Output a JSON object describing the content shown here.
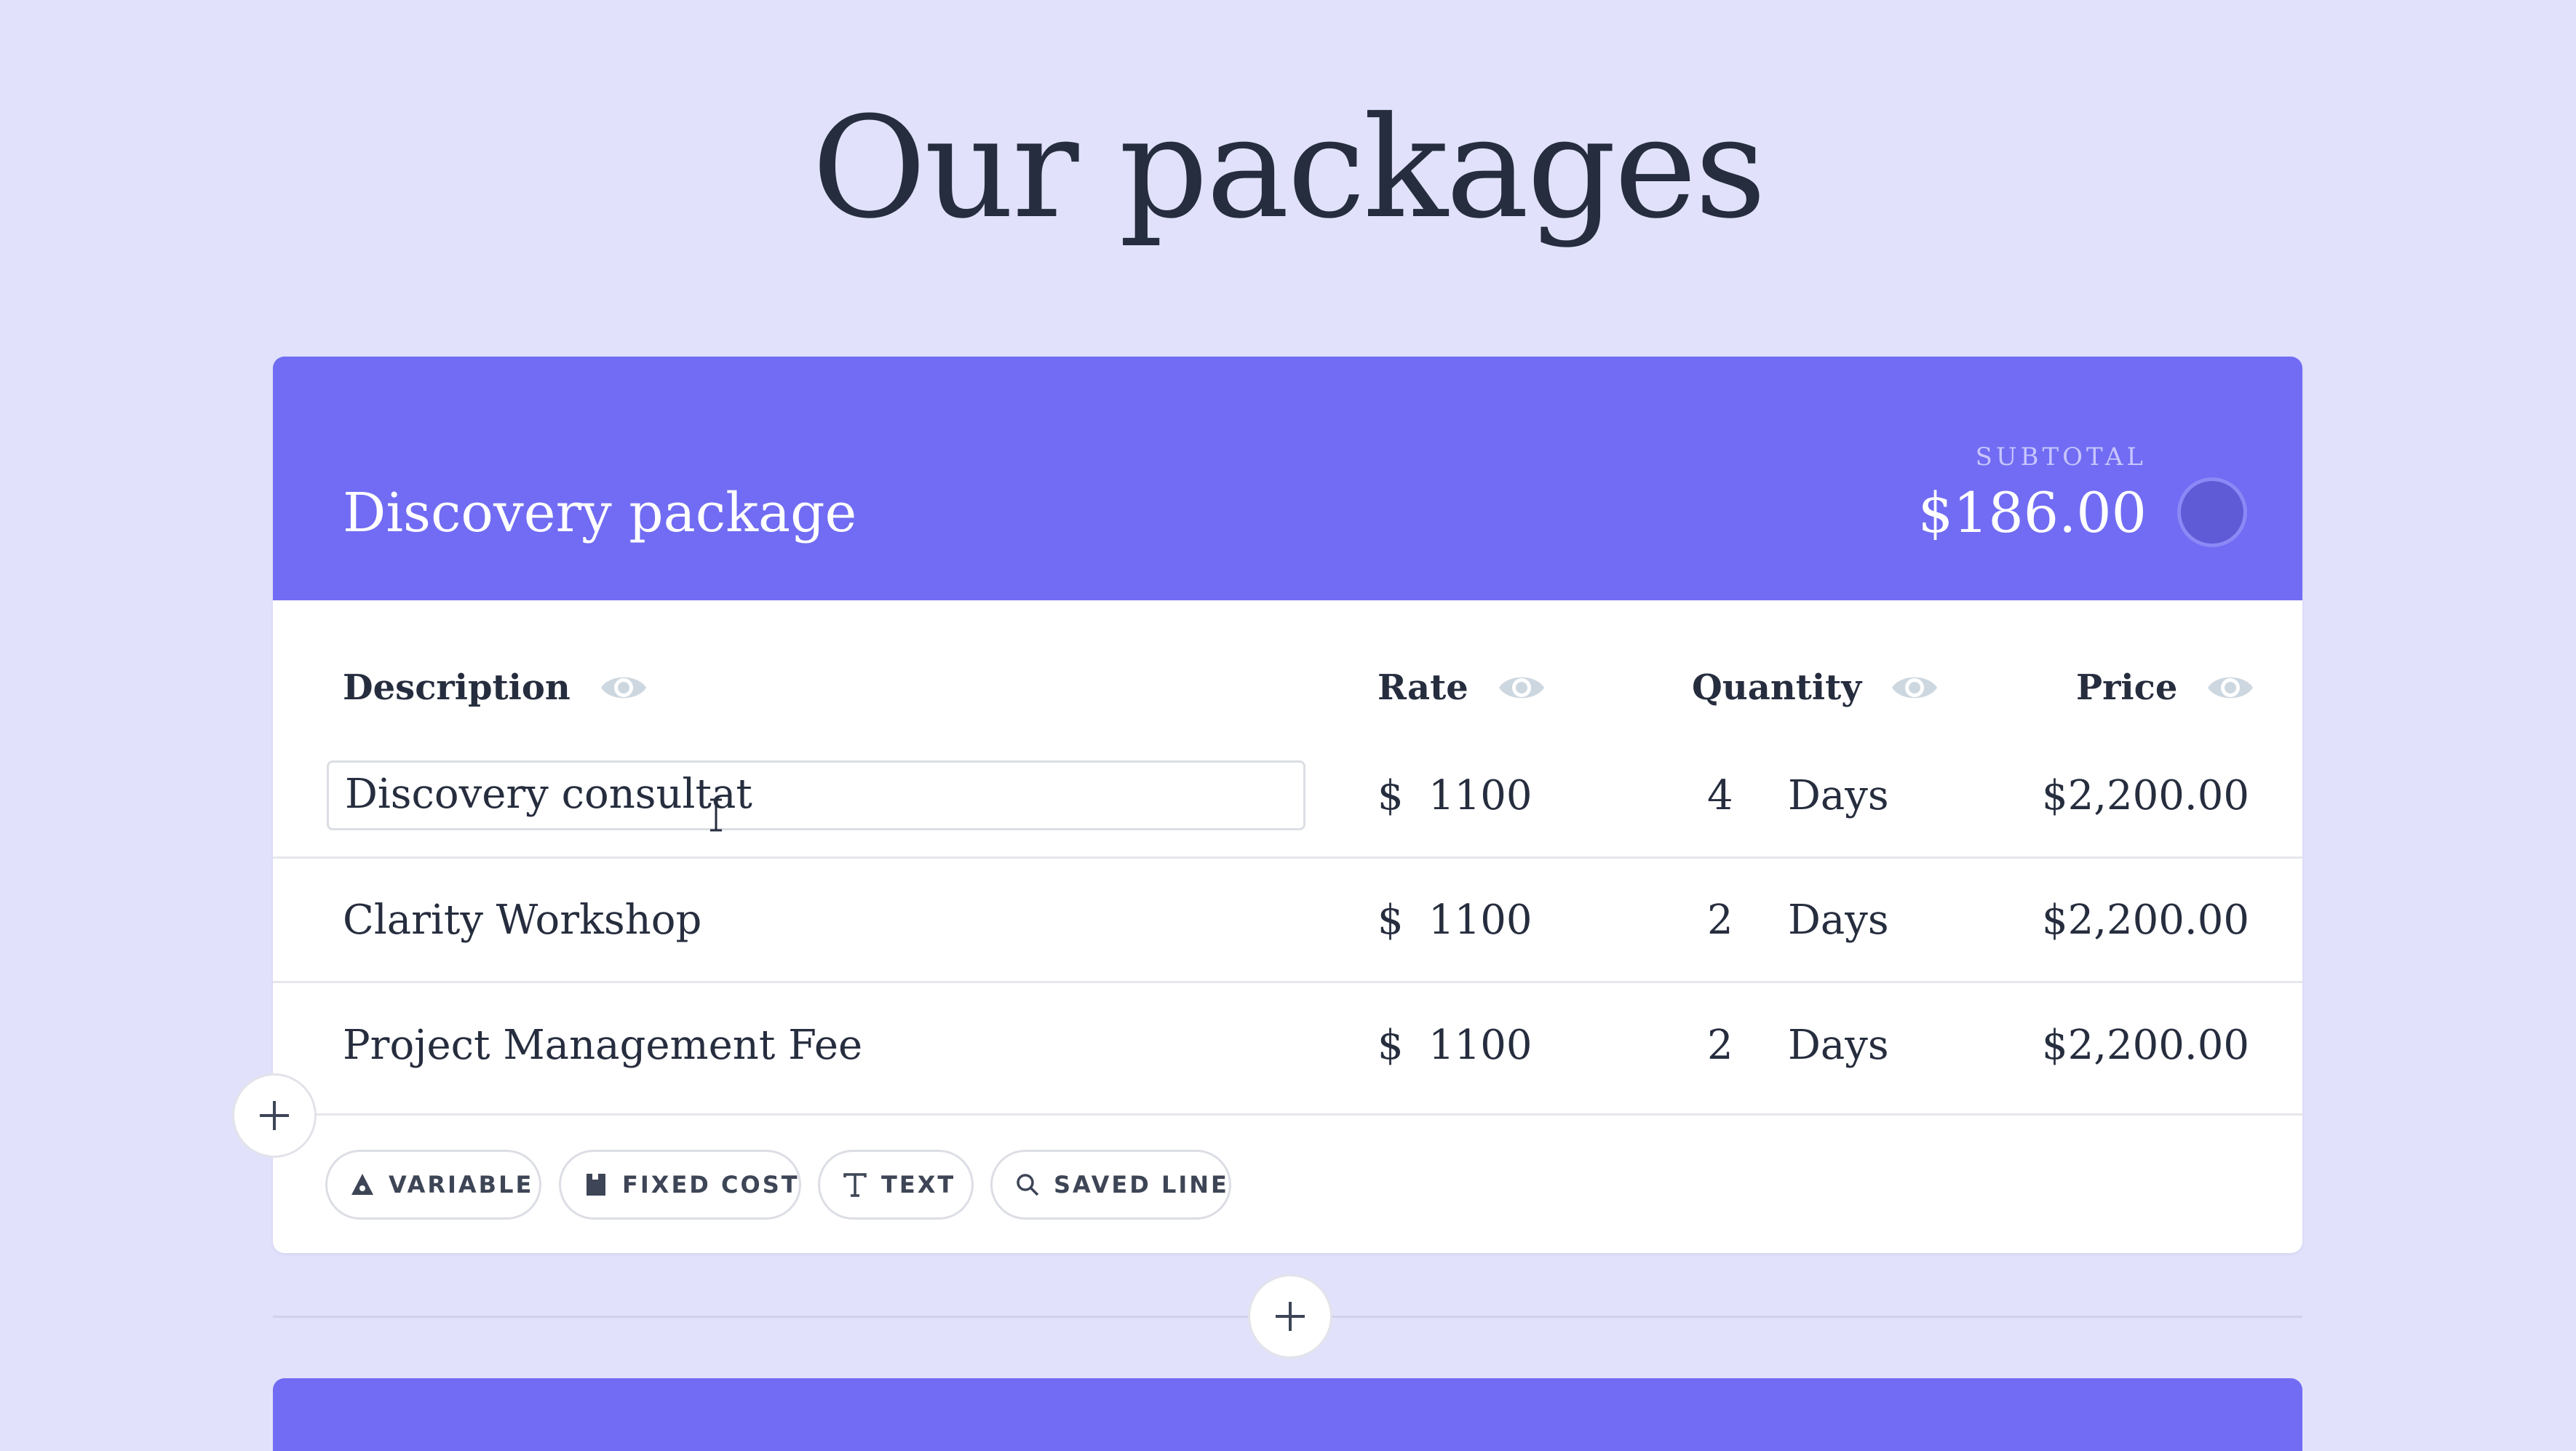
{
  "page": {
    "title": "Our packages"
  },
  "package": {
    "title": "Discovery package",
    "subtotal_label": "SUBTOTAL",
    "subtotal_value": "$186.00"
  },
  "columns": {
    "description": "Description",
    "rate": "Rate",
    "quantity": "Quantity",
    "price": "Price"
  },
  "rows": [
    {
      "description": "Discovery consultat",
      "currency": "$",
      "rate": "1100",
      "quantity": "4",
      "unit": "Days",
      "price": "$2,200.00"
    },
    {
      "description": "Clarity Workshop",
      "currency": "$",
      "rate": "1100",
      "quantity": "2",
      "unit": "Days",
      "price": "$2,200.00"
    },
    {
      "description": "Project Management Fee",
      "currency": "$",
      "rate": "1100",
      "quantity": "2",
      "unit": "Days",
      "price": "$2,200.00"
    }
  ],
  "add_options": [
    {
      "label": "VARIABLE",
      "icon": "triangle-icon"
    },
    {
      "label": "FIXED COST",
      "icon": "tag-icon"
    },
    {
      "label": "TEXT",
      "icon": "text-icon"
    },
    {
      "label": "SAVED LINE",
      "icon": "search-icon"
    }
  ],
  "colors": {
    "background": "#e1e1fb",
    "accent": "#716cf3",
    "text": "#262d3e"
  }
}
